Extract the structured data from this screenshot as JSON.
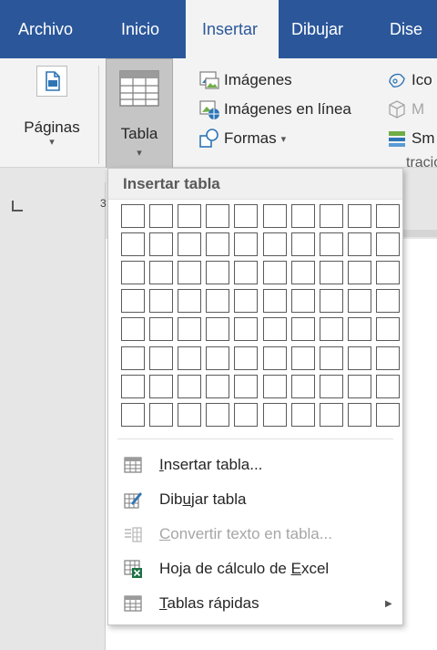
{
  "tabs": [
    {
      "label": "Archivo",
      "active": false
    },
    {
      "label": "Inicio",
      "active": false
    },
    {
      "label": "Insertar",
      "active": true
    },
    {
      "label": "Dibujar",
      "active": false
    },
    {
      "label": "Dise",
      "active": false
    }
  ],
  "ribbon": {
    "paginas": {
      "label": "Páginas",
      "icon": "page-icon"
    },
    "tabla": {
      "label": "Tabla",
      "icon": "table-icon"
    },
    "imagenes": {
      "label": "Imágenes",
      "icon": "image-icon"
    },
    "imagenes_linea": {
      "label": "Imágenes en línea",
      "icon": "online-image-icon"
    },
    "formas": {
      "label": "Formas",
      "icon": "shapes-icon"
    },
    "iconos": {
      "label": "Ico",
      "icon": "icons-icon"
    },
    "modelos": {
      "label": "M",
      "icon": "3d-model-icon"
    },
    "smartart": {
      "label": "Sm",
      "icon": "smartart-icon"
    },
    "ilustraciones": {
      "label": "tracio"
    }
  },
  "ruler": {
    "number": "3"
  },
  "dropdown": {
    "title": "Insertar tabla",
    "grid": {
      "columns": 10,
      "rows": 8
    },
    "items": [
      {
        "pre": "",
        "key": "I",
        "post": "nsertar tabla...",
        "icon": "insert-table-icon",
        "disabled": false
      },
      {
        "pre": "Dib",
        "key": "u",
        "post": "jar tabla",
        "icon": "draw-table-icon",
        "disabled": false
      },
      {
        "pre": "",
        "key": "C",
        "post": "onvertir texto en tabla...",
        "icon": "convert-text-table-icon",
        "disabled": true
      },
      {
        "pre": "Hoja de cálculo de ",
        "key": "E",
        "post": "xcel",
        "icon": "excel-spreadsheet-icon",
        "disabled": false
      },
      {
        "pre": "",
        "key": "T",
        "post": "ablas rápidas",
        "icon": "quick-tables-icon",
        "disabled": false,
        "submenu": true
      }
    ]
  },
  "colors": {
    "accent": "#2b579a",
    "excel_green": "#1e7145",
    "icon_blue": "#2e75b6"
  }
}
